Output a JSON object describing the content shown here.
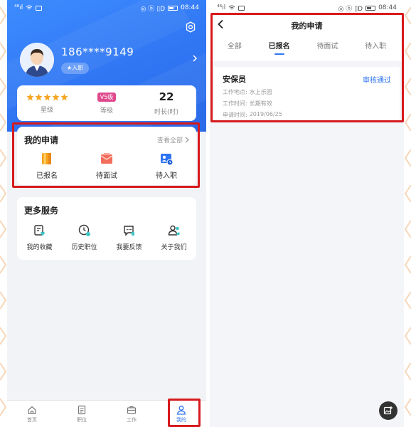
{
  "colors": {
    "brand_blue": "#2f74f2",
    "highlight_red": "#d7191c",
    "star_gold": "#f5a623",
    "level_pink": "#e04a8e",
    "page_bg": "#f2f3f6"
  },
  "left": {
    "statusbar": {
      "signal": "⁴⁶ıl",
      "indicators": "◎ ⓑ ▯D",
      "battery": "▭",
      "time": "08:44"
    },
    "profile": {
      "phone_number": "186****9149",
      "status_pill": "★入职"
    },
    "stats": {
      "stars_label": "星级",
      "level_badge": "V5级",
      "level_label": "等级",
      "hours_value": "22",
      "hours_label": "时长(时)"
    },
    "my_applications": {
      "title": "我的申请",
      "view_all": "查看全部",
      "items": [
        {
          "label": "已报名",
          "icon": "registered-icon"
        },
        {
          "label": "待面试",
          "icon": "interview-icon"
        },
        {
          "label": "待入职",
          "icon": "onboarding-icon"
        }
      ]
    },
    "more_services": {
      "title": "更多服务",
      "items": [
        {
          "label": "我的收藏",
          "icon": "favorites-icon"
        },
        {
          "label": "历史职位",
          "icon": "history-icon"
        },
        {
          "label": "我要反馈",
          "icon": "feedback-icon"
        },
        {
          "label": "关于我们",
          "icon": "about-icon"
        }
      ]
    },
    "bottom_nav": [
      {
        "label": "首页",
        "icon": "home-icon"
      },
      {
        "label": "职位",
        "icon": "jobs-icon"
      },
      {
        "label": "工作",
        "icon": "work-icon"
      },
      {
        "label": "我的",
        "icon": "profile-icon"
      }
    ]
  },
  "right": {
    "statusbar": {
      "signal": "⁴⁶ıl",
      "indicators": "◎ ⓑ ▯D",
      "battery": "▭",
      "time": "08:44"
    },
    "page_title": "我的申请",
    "tabs": [
      "全部",
      "已报名",
      "待面试",
      "待入职"
    ],
    "active_tab": 1,
    "record": {
      "job_title": "安保员",
      "status": "审核通过",
      "location_label": "工作地点:",
      "location_value": "水上乐园",
      "time_label": "工作时间:",
      "time_value": "长期有效",
      "apply_label": "申请时间:",
      "apply_value": "2019/06/25"
    }
  }
}
